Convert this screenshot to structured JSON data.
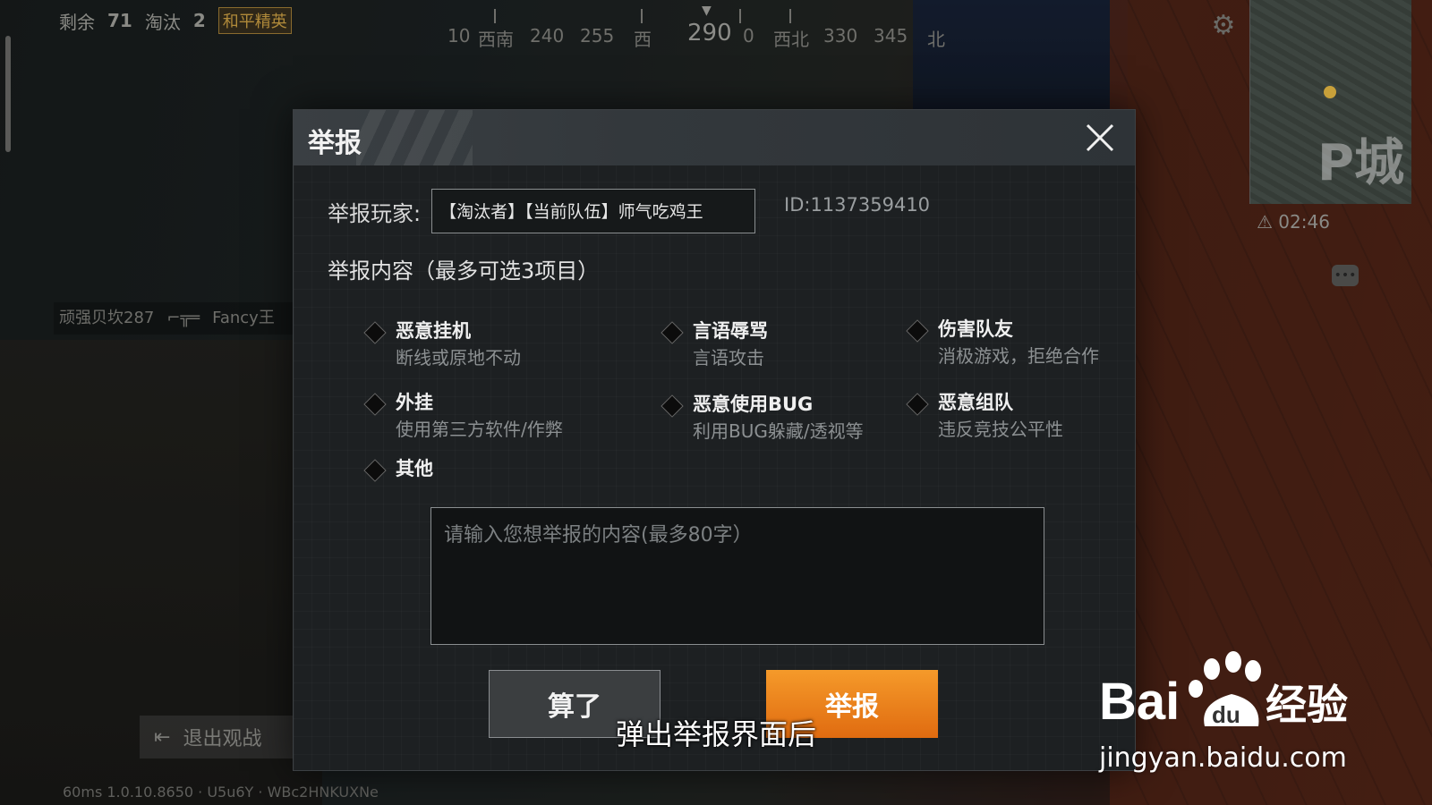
{
  "hud": {
    "remaining_label": "剩余",
    "remaining_count": "71",
    "eliminated_label": "淘汰",
    "eliminated_count": "2",
    "mode_badge": "和平精英",
    "compass": {
      "items": [
        "10",
        "西南",
        "240",
        "255",
        "西",
        "0",
        "西北",
        "330",
        "345",
        "北"
      ],
      "heading": "290"
    },
    "timer": "02:46",
    "minimap_label": "P城",
    "killfeed": [
      "顽强贝坎287",
      "Fancy王"
    ],
    "exit_spectate_label": "退出观战",
    "bottom_status": "60ms  1.0.10.8650 · U5u6Y · WBc2HNKUXNe"
  },
  "dialog": {
    "title": "举报",
    "player_label": "举报玩家:",
    "player_value": "【淘汰者】【当前队伍】师气吃鸡王",
    "player_id": "ID:1137359410",
    "content_heading": "举报内容（最多可选3项目）",
    "options": [
      {
        "title": "恶意挂机",
        "desc": "断线或原地不动"
      },
      {
        "title": "言语辱骂",
        "desc": "言语攻击"
      },
      {
        "title": "伤害队友",
        "desc": "消极游戏，拒绝合作"
      },
      {
        "title": "外挂",
        "desc": "使用第三方软件/作弊"
      },
      {
        "title": "恶意使用BUG",
        "desc": "利用BUG躲藏/透视等"
      },
      {
        "title": "恶意组队",
        "desc": "违反竞技公平性"
      },
      {
        "title": "其他",
        "desc": ""
      }
    ],
    "textarea_placeholder": "请输入您想举报的内容(最多80字）",
    "cancel_label": "算了",
    "report_label": "举报"
  },
  "subtitle": "弹出举报界面后",
  "watermark": {
    "brand": "Bai du 经验",
    "url": "jingyan.baidu.com"
  },
  "colors": {
    "accent": "#f08a1e",
    "dialog_bg": "#1d2022",
    "header_bg": "#3a3f43"
  }
}
